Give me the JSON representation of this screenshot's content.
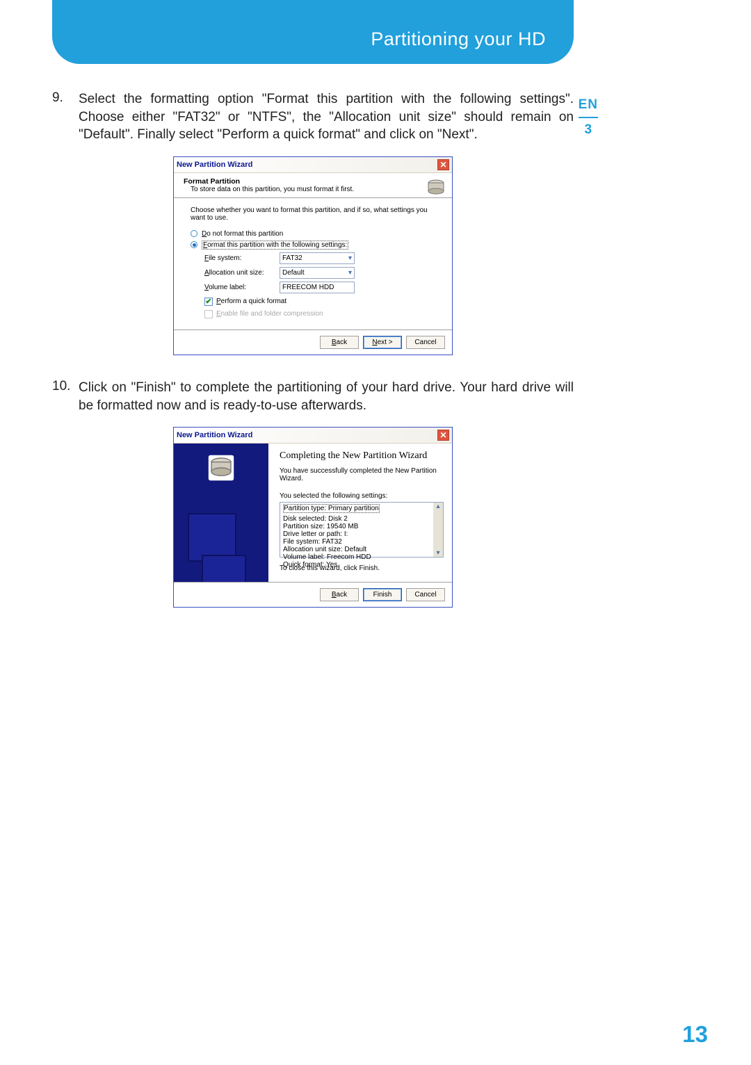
{
  "header": {
    "title": "Partitioning your HD"
  },
  "side": {
    "lang": "EN",
    "chapter": "3"
  },
  "steps": {
    "s9": {
      "num": "9.",
      "text": "Select the formatting option \"Format this partition with the following settings\". Choose either \"FAT32\" or \"NTFS\", the \"Allocation unit size\" should remain on \"Default\". Finally select \"Perform a quick format\" and click on \"Next\"."
    },
    "s10": {
      "num": "10.",
      "text": "Click on \"Finish\" to complete the partitioning of your hard drive. Your hard drive will be formatted now and is ready-to-use afterwards."
    }
  },
  "dlg1": {
    "title": "New Partition Wizard",
    "close": "✕",
    "head1": "Format Partition",
    "head2": "To store data on this partition, you must format it first.",
    "intro": "Choose whether you want to format this partition, and if so, what settings you want to use.",
    "radio_no": "Do not format this partition",
    "radio_yes": "Format this partition with the following settings:",
    "fs_label_u": "F",
    "fs_label_rest": "ile system:",
    "fs_value": "FAT32",
    "au_label_u": "A",
    "au_label_rest": "llocation unit size:",
    "au_value": "Default",
    "vl_label_u": "V",
    "vl_label_rest": "olume label:",
    "vl_value": "FREECOM HDD",
    "cb_quick_u": "P",
    "cb_quick_rest": "erform a quick format",
    "cb_comp_u": "E",
    "cb_comp_rest": "nable file and folder compression",
    "btn_back": "< Back",
    "btn_next": "Next >",
    "btn_cancel": "Cancel"
  },
  "dlg2": {
    "title": "New Partition Wizard",
    "heading": "Completing the New Partition Wizard",
    "success": "You have successfully completed the New Partition Wizard.",
    "selected": "You selected the following settings:",
    "lines": {
      "l0": "Partition type: Primary partition",
      "l1": "Disk selected: Disk 2",
      "l2": "Partition size: 19540 MB",
      "l3": "Drive letter or path: I:",
      "l4": "File system: FAT32",
      "l5": "Allocation unit size: Default",
      "l6": "Volume label: Freecom HDD",
      "l7": "Quick format: Yes"
    },
    "closer": "To close this wizard, click Finish.",
    "btn_back": "< Back",
    "btn_finish": "Finish",
    "btn_cancel": "Cancel"
  },
  "page_number": "13"
}
